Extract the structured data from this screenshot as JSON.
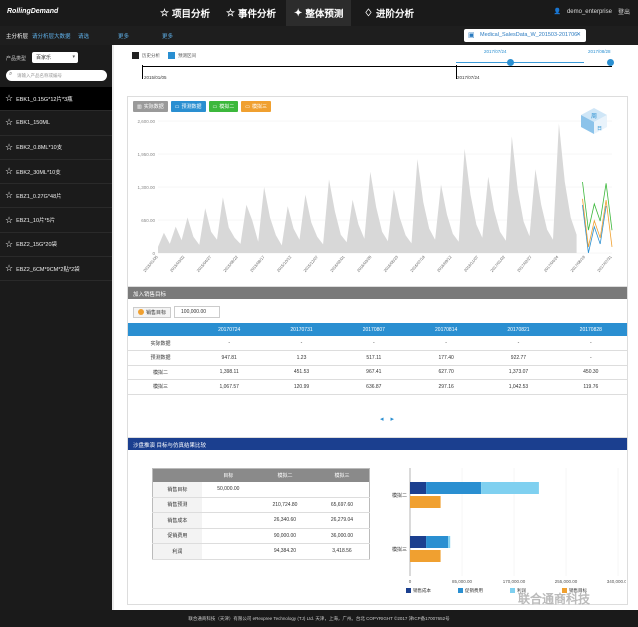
{
  "app": {
    "logo": "RollingDemand",
    "nav": [
      {
        "label": "项目分析",
        "icon": "star-icon"
      },
      {
        "label": "事件分析",
        "icon": "star-icon"
      },
      {
        "label": "整体预测",
        "icon": "wand-icon"
      },
      {
        "label": "进阶分析",
        "icon": "diamond-icon"
      }
    ],
    "user": "demo_enterprise",
    "logout": "登出"
  },
  "breadcrumb": [
    "主分析层",
    "请分析层大数据",
    "请选",
    "更多",
    "更多"
  ],
  "file": {
    "name": "Medical_SalesData_W_201503-201706"
  },
  "sidebar": {
    "type_label": "产品类型",
    "type_value": "百家乐",
    "search_placeholder": "请输入产品名称或编号",
    "products": [
      "EBK1_0.15G*12片*3瓶",
      "EBK1_150ML",
      "EBK2_0.8ML*10支",
      "EBK2_30ML*10支",
      "EBZ1_0.27G*48片",
      "EBZ1_10片*5片",
      "EBZ2_15G*20袋",
      "EBZ2_6CM*9CM*2贴*2袋"
    ],
    "selected_index": 0
  },
  "timeline": {
    "legend": [
      "历史分析",
      "预测区间"
    ],
    "start": "2015/01/05",
    "mid": "2017/07/24",
    "blue_start": "2017/07/24",
    "blue_end": "2017/08/28"
  },
  "chart": {
    "buttons": [
      {
        "label": "实际数据",
        "color": "#9a9a9a"
      },
      {
        "label": "预测数据",
        "color": "#2a8fd1"
      },
      {
        "label": "模拟二",
        "color": "#3cb83c"
      },
      {
        "label": "模拟三",
        "color": "#f0a030"
      }
    ],
    "cube_labels": [
      "周",
      "日"
    ]
  },
  "chart_data": {
    "type": "area",
    "title": "",
    "ylim": [
      0,
      2600
    ],
    "yticks": [
      "2,600.00",
      "1,950.00",
      "1,300.00",
      "650.00",
      "0"
    ],
    "xticks": [
      "2015/01/05",
      "2015/03/02",
      "2015/04/27",
      "2015/06/22",
      "2015/08/17",
      "2015/10/12",
      "2015/12/07",
      "2016/02/01",
      "2016/03/28",
      "2016/05/23",
      "2016/07/18",
      "2016/09/12",
      "2016/11/07",
      "2017/01/02",
      "2017/02/27",
      "2017/04/24",
      "2017/06/19",
      "2017/07/31"
    ],
    "series": [
      {
        "name": "实际数据",
        "color": "#d8d8d8",
        "values": [
          120,
          400,
          180,
          520,
          250,
          700,
          320,
          160,
          880,
          420,
          260,
          1100,
          500,
          300,
          180,
          950,
          640,
          220,
          1300,
          700,
          350,
          150,
          920,
          480,
          260,
          1150,
          600,
          320,
          170,
          1450,
          820,
          360,
          210,
          1050,
          560,
          280,
          1600,
          900,
          420,
          230,
          1250,
          700,
          350,
          190,
          1850,
          1000,
          480,
          260,
          1350,
          760,
          380,
          220,
          2050,
          1150,
          560,
          300,
          1500,
          840,
          420,
          240,
          2300,
          1250,
          620,
          330,
          1650,
          950,
          460,
          260,
          2550,
          1400,
          700,
          360
        ]
      },
      {
        "name": "预测数据",
        "color": "#2a8fd1",
        "values": [
          948,
          1,
          517,
          177,
          923
        ]
      },
      {
        "name": "模拟二",
        "color": "#3cb83c",
        "values": [
          1398,
          452,
          967,
          628,
          1373,
          450
        ]
      },
      {
        "name": "模拟三",
        "color": "#f0a030",
        "values": [
          1068,
          121,
          637,
          297,
          1043,
          120
        ]
      }
    ]
  },
  "forecast": {
    "title": "加入销售目标",
    "target_label": "销售目标",
    "target_value": "100,000.00",
    "columns": [
      "",
      "20170724",
      "20170731",
      "20170807",
      "20170814",
      "20170821",
      "20170828"
    ],
    "rows": [
      [
        "实际数据",
        "-",
        "-",
        "-",
        "-",
        "-",
        "-"
      ],
      [
        "预测数据",
        "947.81",
        "1.23",
        "517.11",
        "177.40",
        "922.77",
        "-"
      ],
      [
        "模拟二",
        "1,398.11",
        "451.53",
        "967.41",
        "627.70",
        "1,373.07",
        "450.30"
      ],
      [
        "模拟三",
        "1,067.57",
        "120.99",
        "636.87",
        "297.16",
        "1,042.53",
        "119.76"
      ]
    ]
  },
  "sim": {
    "title": "沙盘推演   目标与仿真结果比较",
    "columns": [
      "",
      "目标",
      "模拟二",
      "模拟三"
    ],
    "rows": [
      [
        "销售目标",
        "50,000.00",
        "",
        ""
      ],
      [
        "销售预测",
        "",
        "210,724.80",
        "65,697.60"
      ],
      [
        "销售成本",
        "",
        "26,340.60",
        "26,279.04"
      ],
      [
        "促销费用",
        "",
        "90,000.00",
        "36,000.00"
      ],
      [
        "利润",
        "",
        "94,384.20",
        "3,418.56"
      ]
    ],
    "bars": {
      "categories": [
        "模拟二",
        "模拟三"
      ],
      "xticks": [
        "0",
        "85,000.00",
        "170,000.00",
        "255,000.00",
        "340,000.00"
      ],
      "xmax": 340000,
      "legend": [
        {
          "name": "销售成本",
          "color": "#1b3f8f"
        },
        {
          "name": "促销费用",
          "color": "#2a8fd1"
        },
        {
          "name": "利润",
          "color": "#7fd0f0"
        },
        {
          "name": "销售目标",
          "color": "#f0a030"
        }
      ],
      "values": {
        "模拟二": {
          "销售成本": 26340.6,
          "促销费用": 90000.0,
          "利润": 94384.2,
          "销售目标": 50000.0
        },
        "模拟三": {
          "销售成本": 26279.04,
          "促销费用": 36000.0,
          "利润": 3418.56,
          "销售目标": 50000.0
        }
      }
    }
  },
  "footer": "联合通商科技（天津）有限公司 eRexpree Technology (TJ) Ltd. 天津，上海，广州。台北 COPYRIGHT ©2017 津ICP备17007652号",
  "watermark": "联合通商科技"
}
